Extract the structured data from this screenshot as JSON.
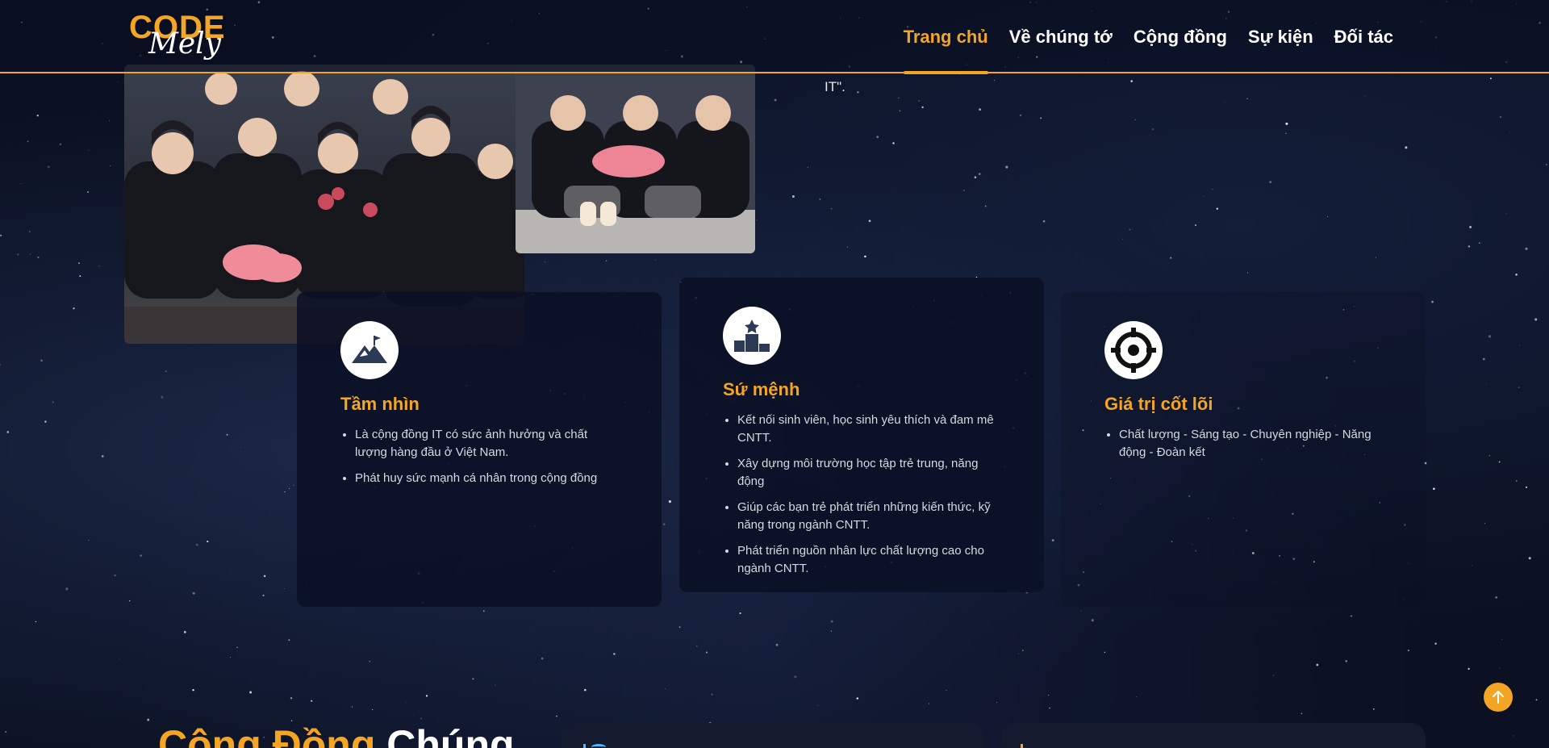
{
  "header": {
    "logo": {
      "code": "CODE",
      "mely": "Mely"
    },
    "nav": [
      {
        "label": "Trang chủ",
        "active": true
      },
      {
        "label": "Về chúng tớ",
        "active": false
      },
      {
        "label": "Cộng đồng",
        "active": false
      },
      {
        "label": "Sự kiện",
        "active": false
      },
      {
        "label": "Đối tác",
        "active": false
      }
    ]
  },
  "intro": {
    "tail_text": "IT\"."
  },
  "cards": {
    "vision": {
      "icon": "mountain-flag-icon",
      "title": "Tầm nhìn",
      "items": [
        "Là cộng đồng IT có sức ảnh hưởng và chất lượng hàng đầu ở Việt Nam.",
        "Phát huy sức mạnh cá nhân trong cộng đồng"
      ]
    },
    "mission": {
      "icon": "podium-star-icon",
      "title": "Sứ mệnh",
      "items": [
        "Kết nối sinh viên, học sinh yêu thích và đam mê CNTT.",
        "Xây dựng môi trường học tập trẻ trung, năng động",
        "Giúp các bạn trẻ phát triển những kiến thức, kỹ năng trong ngành CNTT.",
        "Phát triển nguồn nhân lực chất lượng cao cho ngành CNTT."
      ]
    },
    "values": {
      "icon": "target-icon",
      "title": "Giá trị cốt lõi",
      "items": [
        "Chất lượng - Sáng tạo - Chuyên nghiệp - Năng động - Đoàn kết"
      ]
    }
  },
  "community": {
    "title_orange": "Cộng Đồng",
    "title_white": "Chúng"
  },
  "colors": {
    "accent": "#f5a524",
    "background": "#0b1122",
    "card": "#0a1024"
  }
}
